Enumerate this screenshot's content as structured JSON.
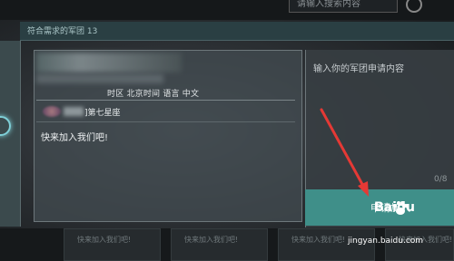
{
  "search": {
    "placeholder": "请输入搜索内容"
  },
  "filter": {
    "label": "符合需求的军团 13"
  },
  "guild": {
    "info": "时区 北京时间  语言 中文",
    "name": "]第七星座",
    "slogan": "快来加入我们吧!"
  },
  "apply": {
    "placeholder": "输入你的军团申请内容",
    "counter": "0/8",
    "button_label": "申请加入"
  },
  "bottom_cards": [
    "快来加入我们吧!",
    "快来加入我们吧!",
    "快来加入我们吧!",
    "快来加入我们吧!"
  ],
  "watermark": {
    "brand": "Baidu",
    "site": "jingyan.baidu.com"
  },
  "colors": {
    "accent": "#3f8f89",
    "arrow": "#e53935"
  }
}
